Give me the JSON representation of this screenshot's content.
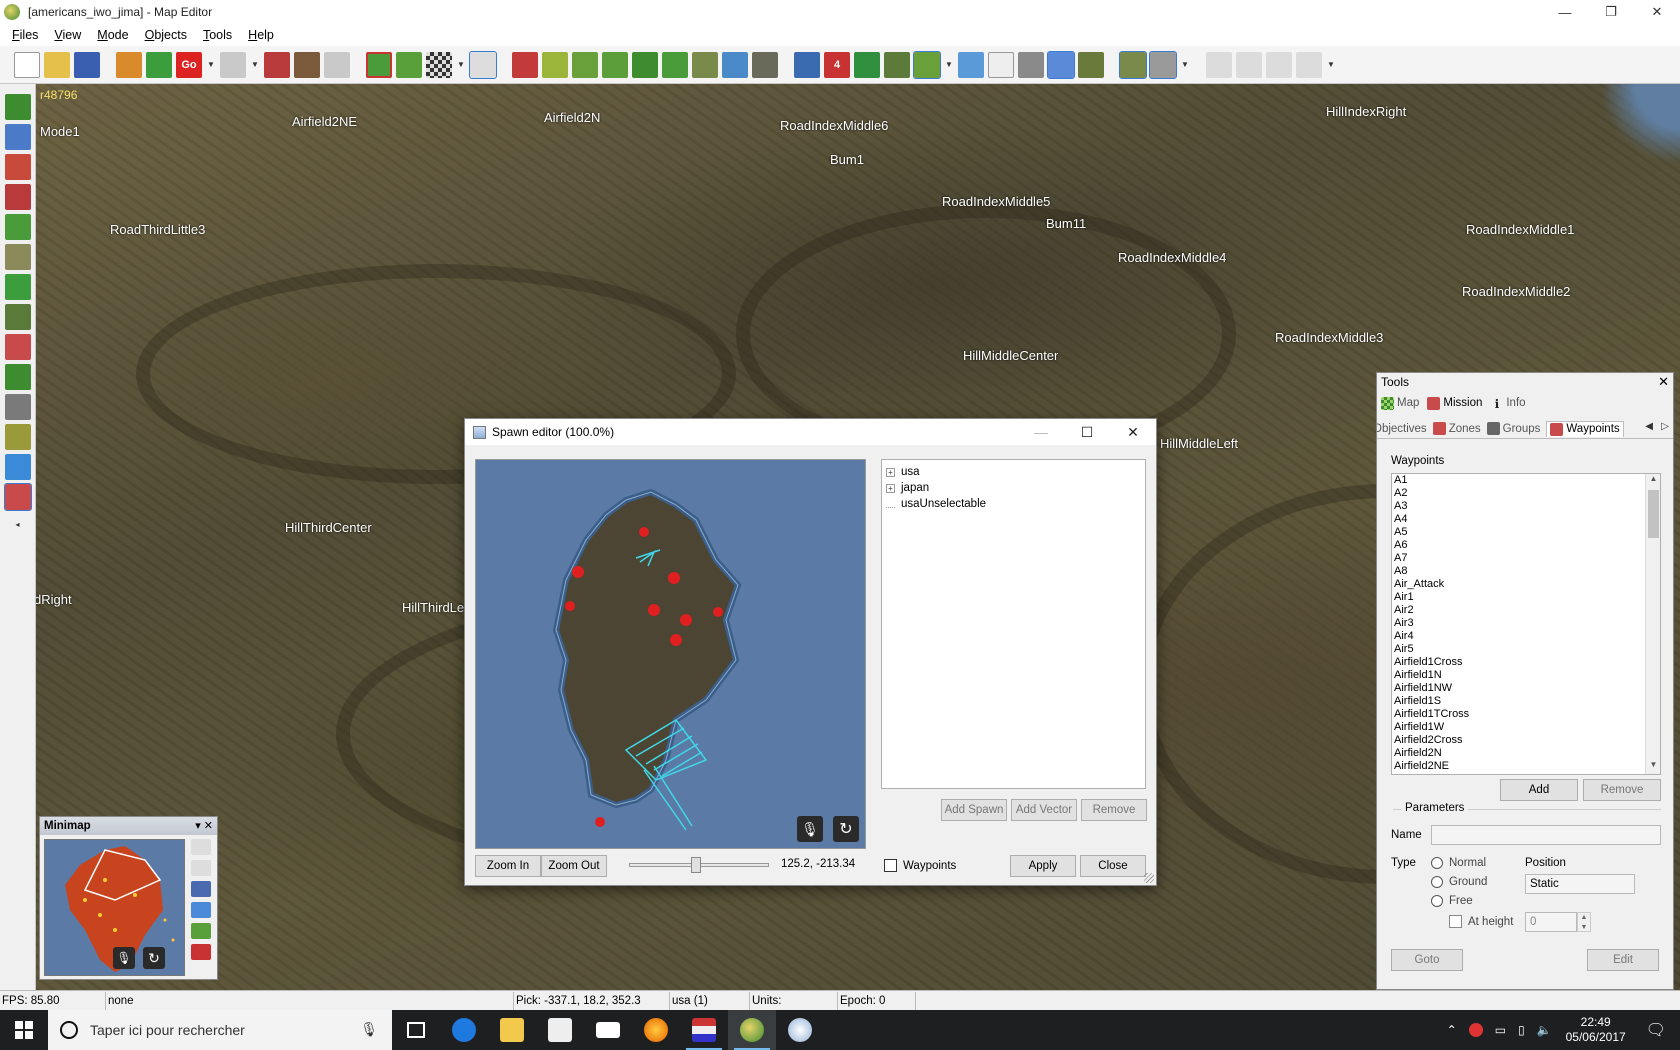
{
  "window": {
    "title": "[americans_iwo_jima] - Map Editor",
    "controls": [
      "—",
      "❐",
      "✕"
    ]
  },
  "menu": [
    {
      "accel": "F",
      "rest": "iles"
    },
    {
      "accel": "V",
      "rest": "iew"
    },
    {
      "accel": "M",
      "rest": "ode"
    },
    {
      "accel": "O",
      "rest": "bjects"
    },
    {
      "accel": "T",
      "rest": "ools"
    },
    {
      "accel": "H",
      "rest": "elp"
    }
  ],
  "toolbar": {
    "go_label": "Go",
    "badge_number": "4"
  },
  "viewport": {
    "version": "r48796",
    "labels": {
      "l0": "Mode1",
      "l1": "Airfield2NE",
      "l2": "Airfield2N",
      "l3": "RoadIndexMiddle6",
      "l4": "Bum1",
      "l5": "HillIndexRight",
      "l6": "RoadThirdLittle3",
      "l7": "RoadIndexMiddle5",
      "l8": "Bum11",
      "l9": "RoadIndexMiddle4",
      "l10": "RoadIndexMiddle1",
      "l11": "RoadIndexMiddle2",
      "l12": "RoadIndexMiddle3",
      "l13": "HillMiddleCenter",
      "l14": "HillMiddleLeft",
      "l15": "HillThirdCenter",
      "l16": "dRight",
      "l17": "HillThirdLe"
    }
  },
  "spawn_editor": {
    "title": "Spawn editor (100.0%)",
    "tree": {
      "usa": "usa",
      "japan": "japan",
      "unselectable": "usaUnselectable"
    },
    "buttons": {
      "add_spawn": "Add Spawn",
      "add_vector": "Add Vector",
      "remove": "Remove",
      "zoom_in": "Zoom In",
      "zoom_out": "Zoom Out",
      "apply": "Apply",
      "close": "Close"
    },
    "coords": "125.2, -213.34",
    "zoom_slider": 0.48,
    "waypoints_label": "Waypoints",
    "waypoints_checked": false
  },
  "minimap": {
    "title": "Minimap"
  },
  "tools": {
    "title": "Tools",
    "tabs_top": {
      "map": "Map",
      "mission": "Mission",
      "info": "Info"
    },
    "tabs_sub": {
      "objectives": "Objectives",
      "zones": "Zones",
      "groups": "Groups",
      "waypoints": "Waypoints"
    },
    "waypoints_label": "Waypoints",
    "waypoints": {
      "w0": "A1",
      "w1": "A2",
      "w2": "A3",
      "w3": "A4",
      "w4": "A5",
      "w5": "A6",
      "w6": "A7",
      "w7": "A8",
      "w8": "Air_Attack",
      "w9": "Air1",
      "w10": "Air2",
      "w11": "Air3",
      "w12": "Air4",
      "w13": "Air5",
      "w14": "Airfield1Cross",
      "w15": "Airfield1N",
      "w16": "Airfield1NW",
      "w17": "Airfield1S",
      "w18": "Airfield1TCross",
      "w19": "Airfield1W",
      "w20": "Airfield2Cross",
      "w21": "Airfield2N",
      "w22": "Airfield2NE"
    },
    "buttons": {
      "add": "Add",
      "remove": "Remove",
      "goto": "Goto",
      "edit": "Edit"
    },
    "parameters": {
      "title": "Parameters",
      "name_label": "Name",
      "name_value": "",
      "type_label": "Type",
      "types": {
        "normal": "Normal",
        "ground": "Ground",
        "free": "Free"
      },
      "at_height_label": "At height",
      "at_height_value": "0",
      "position_label": "Position",
      "position_value": "Static"
    }
  },
  "status": {
    "fps": "FPS: 85.80",
    "selection": "none",
    "pick": "Pick: -337.1, 18.2, 352.3",
    "side": "usa (1)",
    "units": "Units:",
    "epoch": "Epoch: 0"
  },
  "taskbar": {
    "search_placeholder": "Taper ici pour rechercher",
    "time": "22:49",
    "date": "05/06/2017"
  },
  "colors": {
    "accent": "#3a7bd5",
    "water": "#5b7ba6",
    "spawn_red": "#e02020",
    "spawn_cyan": "#3fd8e8"
  }
}
